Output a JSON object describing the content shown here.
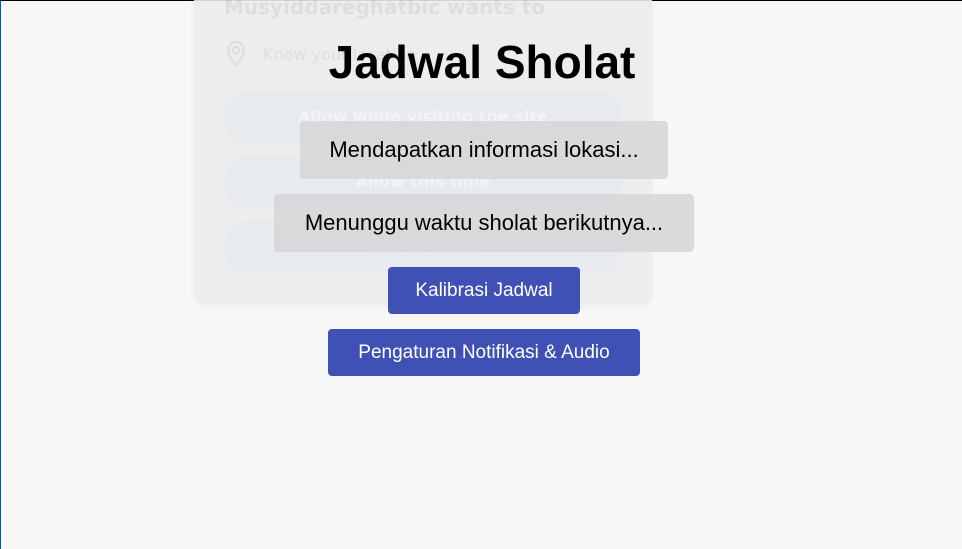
{
  "permission_popup": {
    "title": "Musyiddareghatbic wants to",
    "location_text": "Know your location",
    "options": [
      "Allow while visiting the site",
      "Allow this time",
      "Never allow"
    ]
  },
  "app": {
    "title": "Jadwal Sholat",
    "status_location": "Mendapatkan informasi lokasi...",
    "status_next_prayer": "Menunggu waktu sholat berikutnya...",
    "calibrate_button": "Kalibrasi Jadwal",
    "settings_button": "Pengaturan Notifikasi & Audio"
  },
  "colors": {
    "background": "#f7f7f8",
    "button": "#3f51b5",
    "status_box": "#d6d6d8"
  },
  "icons": {
    "location": "map-pin-icon"
  }
}
